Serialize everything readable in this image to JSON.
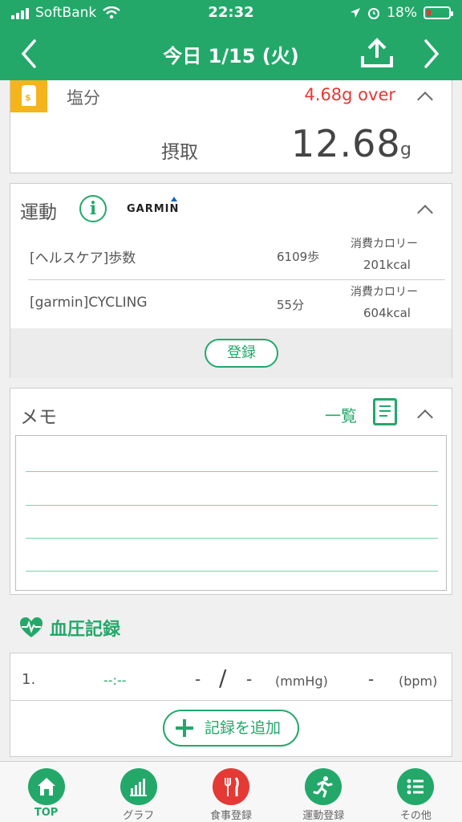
{
  "status_bar": {
    "carrier": "SoftBank",
    "time": "22:32",
    "battery": "18%",
    "battery_level": 0.18
  },
  "header": {
    "title": "今日 1/15 (火)",
    "prev_label": "<",
    "next_label": ">"
  },
  "salt": {
    "title": "塩分",
    "over": "4.68g over",
    "intake_label": "摂取",
    "intake_value": "12.68",
    "intake_unit": "g"
  },
  "exercise": {
    "title": "運動",
    "partner": "GARMIN",
    "rows": [
      {
        "name": "[ヘルスケア]歩数",
        "qty": "6109歩",
        "cal_label": "消費カロリー",
        "cal_value": "201kcal"
      },
      {
        "name": "[garmin]CYCLING",
        "qty": "55分",
        "cal_label": "消費カロリー",
        "cal_value": "604kcal"
      }
    ],
    "register_label": "登録"
  },
  "memo": {
    "title": "メモ",
    "list_label": "一覧"
  },
  "blood_pressure": {
    "heading": "血圧記録",
    "row_number": "1.",
    "time": "--:--",
    "systolic": "-",
    "slash": "/",
    "diastolic": "-",
    "bp_unit": "(mmHg)",
    "pulse": "-",
    "pulse_unit": "(bpm)",
    "add_label": "記録を追加"
  },
  "tabbar": {
    "tabs": [
      {
        "label": "TOP",
        "icon": "home-icon",
        "active": true
      },
      {
        "label": "グラフ",
        "icon": "bar-chart-icon",
        "active": false
      },
      {
        "label": "食事登録",
        "icon": "fork-knife-icon",
        "active": false
      },
      {
        "label": "運動登録",
        "icon": "runner-icon",
        "active": false
      },
      {
        "label": "その他",
        "icon": "list-icon",
        "active": false
      }
    ]
  },
  "colors": {
    "brand_green": "#23a86a",
    "over_red": "#e53935",
    "salt_yellow": "#f5b41c"
  }
}
